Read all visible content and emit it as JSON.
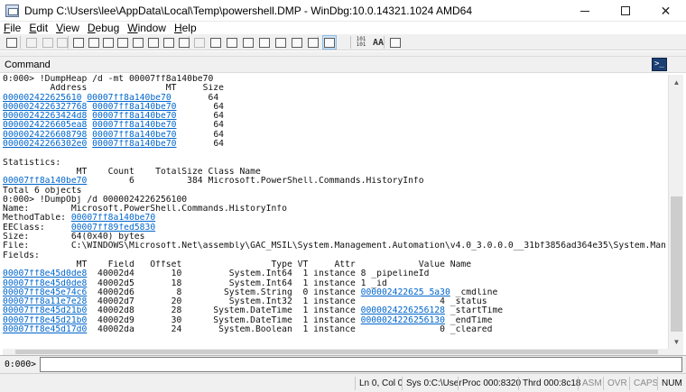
{
  "window": {
    "title": "Dump C:\\Users\\lee\\AppData\\Local\\Temp\\powershell.DMP - WinDbg:10.0.14321.1024 AMD64"
  },
  "menu": {
    "items": [
      {
        "underline": "F",
        "rest": "ile"
      },
      {
        "underline": "E",
        "rest": "dit"
      },
      {
        "underline": "V",
        "rest": "iew"
      },
      {
        "underline": "D",
        "rest": "ebug"
      },
      {
        "underline": "W",
        "rest": "indow"
      },
      {
        "underline": "H",
        "rest": "elp"
      }
    ]
  },
  "toolbar": {
    "icons": [
      "open-icon",
      "cut-icon",
      "copy-icon",
      "paste-icon",
      "go-icon",
      "restart-icon",
      "stop-debugging-icon",
      "break-icon",
      "step-into-icon",
      "step-over-icon",
      "step-out-icon",
      "run-to-cursor-icon",
      "command-window-icon",
      "watch-window-icon",
      "locals-window-icon",
      "registers-window-icon",
      "memory-window-icon",
      "call-stack-icon",
      "disassembly-icon",
      "scratch-pad-icon",
      "source-mode-icon",
      "hex-mode-icon",
      "font-icon",
      "options-icon"
    ],
    "hex_label": "101\n101",
    "font_label": "AA"
  },
  "command_window": {
    "title": "Command",
    "icon_glyph": ">_",
    "lines": [
      [
        {
          "t": "0:000> !DumpHeap /d -mt 00007ff8a140be70"
        }
      ],
      [
        {
          "t": "         Address               MT     Size"
        }
      ],
      [
        {
          "t": "000002422625610",
          "l": true
        },
        {
          "t": " "
        },
        {
          "t": "00007ff8a140be70",
          "l": true
        },
        {
          "t": "       64"
        }
      ],
      [
        {
          "t": "0000024226327768",
          "l": true
        },
        {
          "t": " "
        },
        {
          "t": "00007ff8a140be70",
          "l": true
        },
        {
          "t": "       64"
        }
      ],
      [
        {
          "t": "00000242263424d8",
          "l": true
        },
        {
          "t": " "
        },
        {
          "t": "00007ff8a140be70",
          "l": true
        },
        {
          "t": "       64"
        }
      ],
      [
        {
          "t": "0000024226605ea8",
          "l": true
        },
        {
          "t": " "
        },
        {
          "t": "00007ff8a140be70",
          "l": true
        },
        {
          "t": "       64"
        }
      ],
      [
        {
          "t": "0000024226608798",
          "l": true
        },
        {
          "t": " "
        },
        {
          "t": "00007ff8a140be70",
          "l": true
        },
        {
          "t": "       64"
        }
      ],
      [
        {
          "t": "00000242266302e0",
          "l": true
        },
        {
          "t": " "
        },
        {
          "t": "00007ff8a140be70",
          "l": true
        },
        {
          "t": "       64"
        }
      ],
      [
        {
          "t": ""
        }
      ],
      [
        {
          "t": "Statistics:"
        }
      ],
      [
        {
          "t": "              MT    Count    TotalSize Class Name"
        }
      ],
      [
        {
          "t": "00007ff8a140be70",
          "l": true
        },
        {
          "t": "        6          384 Microsoft.PowerShell.Commands.HistoryInfo"
        }
      ],
      [
        {
          "t": "Total 6 objects"
        }
      ],
      [
        {
          "t": "0:000> !DumpObj /d 0000024226256100"
        }
      ],
      [
        {
          "t": "Name:        Microsoft.PowerShell.Commands.HistoryInfo"
        }
      ],
      [
        {
          "t": "MethodTable: "
        },
        {
          "t": "00007ff8a140be70",
          "l": true
        }
      ],
      [
        {
          "t": "EEClass:     "
        },
        {
          "t": "00007ff89fed5830",
          "l": true
        }
      ],
      [
        {
          "t": "Size:        64(0x40) bytes"
        }
      ],
      [
        {
          "t": "File:        C:\\WINDOWS\\Microsoft.Net\\assembly\\GAC_MSIL\\System.Management.Automation\\v4.0_3.0.0.0__31bf3856ad364e35\\System.Manageme"
        }
      ],
      [
        {
          "t": "Fields:"
        }
      ],
      [
        {
          "t": "              MT    Field   Offset                 Type VT     Attr            Value Name"
        }
      ],
      [
        {
          "t": "00007ff8e45d0de8",
          "l": true
        },
        {
          "t": "  40002d4       10         System.Int64  1 instance 8 _pipelineId"
        }
      ],
      [
        {
          "t": "00007ff8e45d0de8",
          "l": true
        },
        {
          "t": "  40002d5       18         System.Int64  1 instance 1 _id"
        }
      ],
      [
        {
          "t": "00007ff8e45e74c6",
          "l": true
        },
        {
          "t": "  40002d6        8        System.String  0 instance "
        },
        {
          "t": "000002422625 5a30",
          "l": true
        },
        {
          "t": " _cmdline"
        }
      ],
      [
        {
          "t": "00007ff8a11e7e28",
          "l": true
        },
        {
          "t": "  40002d7       20         System.Int32  1 instance                4 _status"
        }
      ],
      [
        {
          "t": "00007ff8e45d21b0",
          "l": true
        },
        {
          "t": "  40002d8       28      System.DateTime  1 instance "
        },
        {
          "t": "0000024226256128",
          "l": true
        },
        {
          "t": " _startTime"
        }
      ],
      [
        {
          "t": "00007ff8e45d21b0",
          "l": true
        },
        {
          "t": "  40002d9       30      System.DateTime  1 instance "
        },
        {
          "t": "0000024226256130",
          "l": true
        },
        {
          "t": " _endTime"
        }
      ],
      [
        {
          "t": "00007ff8e45d17d0",
          "l": true
        },
        {
          "t": "  40002da       24       System.Boolean  1 instance                0 _cleared"
        }
      ]
    ]
  },
  "command_input": {
    "prompt": "0:000>",
    "value": ""
  },
  "status": {
    "line_col": "Ln 0, Col 0",
    "sys": "Sys 0:C:\\User",
    "proc": "Proc 000:8320",
    "thrd": "Thrd 000:8c18",
    "asm": "ASM",
    "ovr": "OVR",
    "caps": "CAPS",
    "num": "NUM"
  }
}
